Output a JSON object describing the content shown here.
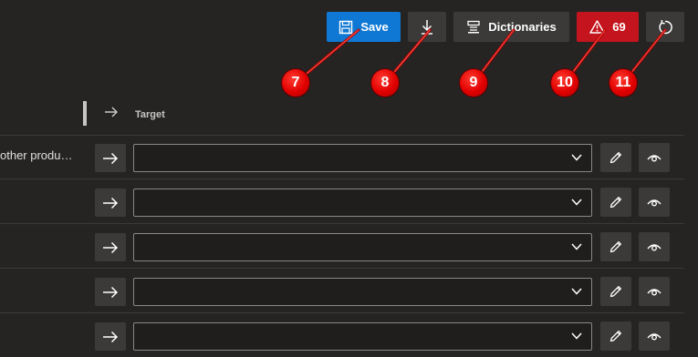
{
  "toolbar": {
    "save_label": "Save",
    "dictionaries_label": "Dictionaries",
    "error_count": "69"
  },
  "callouts": [
    "7",
    "8",
    "9",
    "10",
    "11"
  ],
  "table": {
    "target_header": "Target",
    "rows": [
      {
        "source": "other produ…"
      },
      {
        "source": ""
      },
      {
        "source": ""
      },
      {
        "source": ""
      },
      {
        "source": ""
      }
    ]
  },
  "colors": {
    "background": "#252423",
    "primary": "#0f78d4",
    "danger": "#c4141d",
    "button": "#3b3a39",
    "callout": "#e00000"
  }
}
